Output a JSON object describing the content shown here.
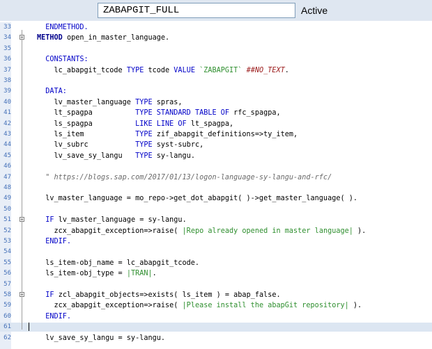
{
  "header": {
    "program_name": "ZABAPGIT_FULL",
    "status": "Active"
  },
  "editor": {
    "lines": [
      {
        "num": "33",
        "fold": false,
        "segments": [
          {
            "t": "  ENDMETHOD.",
            "c": "kw"
          }
        ]
      },
      {
        "num": "34",
        "fold": true,
        "segments": [
          {
            "t": "METHOD",
            "c": "kwb"
          },
          {
            "t": " open_in_master_language."
          }
        ]
      },
      {
        "num": "35",
        "fold": false,
        "segments": []
      },
      {
        "num": "36",
        "fold": false,
        "segments": [
          {
            "t": "  CONSTANTS:",
            "c": "kw"
          }
        ]
      },
      {
        "num": "37",
        "fold": false,
        "segments": [
          {
            "t": "    lc_abapgit_tcode "
          },
          {
            "t": "TYPE",
            "c": "kw"
          },
          {
            "t": " tcode "
          },
          {
            "t": "VALUE",
            "c": "kw"
          },
          {
            "t": " "
          },
          {
            "t": "`ZABAPGIT`",
            "c": "str"
          },
          {
            "t": " "
          },
          {
            "t": "##NO_TEXT",
            "c": "pragma"
          },
          {
            "t": "."
          }
        ]
      },
      {
        "num": "38",
        "fold": false,
        "segments": []
      },
      {
        "num": "39",
        "fold": false,
        "segments": [
          {
            "t": "  DATA:",
            "c": "kw"
          }
        ]
      },
      {
        "num": "40",
        "fold": false,
        "segments": [
          {
            "t": "    lv_master_language "
          },
          {
            "t": "TYPE",
            "c": "kw"
          },
          {
            "t": " spras,"
          }
        ]
      },
      {
        "num": "41",
        "fold": false,
        "segments": [
          {
            "t": "    lt_spagpa          "
          },
          {
            "t": "TYPE STANDARD TABLE OF",
            "c": "kw"
          },
          {
            "t": " rfc_spagpa,"
          }
        ]
      },
      {
        "num": "42",
        "fold": false,
        "segments": [
          {
            "t": "    ls_spagpa          "
          },
          {
            "t": "LIKE LINE OF",
            "c": "kw"
          },
          {
            "t": " lt_spagpa,"
          }
        ]
      },
      {
        "num": "43",
        "fold": false,
        "segments": [
          {
            "t": "    ls_item            "
          },
          {
            "t": "TYPE",
            "c": "kw"
          },
          {
            "t": " zif_abapgit_definitions=>ty_item,"
          }
        ]
      },
      {
        "num": "44",
        "fold": false,
        "segments": [
          {
            "t": "    lv_subrc           "
          },
          {
            "t": "TYPE",
            "c": "kw"
          },
          {
            "t": " syst-subrc,"
          }
        ]
      },
      {
        "num": "45",
        "fold": false,
        "segments": [
          {
            "t": "    lv_save_sy_langu   "
          },
          {
            "t": "TYPE",
            "c": "kw"
          },
          {
            "t": " sy-langu."
          }
        ]
      },
      {
        "num": "46",
        "fold": false,
        "segments": []
      },
      {
        "num": "47",
        "fold": false,
        "segments": [
          {
            "t": "  \" https://blogs.sap.com/2017/01/13/logon-language-sy-langu-and-rfc/",
            "c": "com"
          }
        ]
      },
      {
        "num": "48",
        "fold": false,
        "segments": []
      },
      {
        "num": "49",
        "fold": false,
        "segments": [
          {
            "t": "  lv_master_language = mo_repo->get_dot_abapgit( )->get_master_language( )."
          }
        ]
      },
      {
        "num": "50",
        "fold": false,
        "segments": []
      },
      {
        "num": "51",
        "fold": true,
        "segments": [
          {
            "t": "  "
          },
          {
            "t": "IF",
            "c": "kw"
          },
          {
            "t": " lv_master_language = sy-langu."
          }
        ]
      },
      {
        "num": "52",
        "fold": false,
        "segments": [
          {
            "t": "    zcx_abapgit_exception=>raise( "
          },
          {
            "t": "|Repo already opened in master language|",
            "c": "str"
          },
          {
            "t": " )."
          }
        ]
      },
      {
        "num": "53",
        "fold": false,
        "segments": [
          {
            "t": "  ENDIF.",
            "c": "kw"
          }
        ]
      },
      {
        "num": "54",
        "fold": false,
        "segments": []
      },
      {
        "num": "55",
        "fold": false,
        "segments": [
          {
            "t": "  ls_item-obj_name = lc_abapgit_tcode."
          }
        ]
      },
      {
        "num": "56",
        "fold": false,
        "segments": [
          {
            "t": "  ls_item-obj_type = "
          },
          {
            "t": "|TRAN|",
            "c": "str"
          },
          {
            "t": "."
          }
        ]
      },
      {
        "num": "57",
        "fold": false,
        "segments": []
      },
      {
        "num": "58",
        "fold": true,
        "segments": [
          {
            "t": "  "
          },
          {
            "t": "IF",
            "c": "kw"
          },
          {
            "t": " zcl_abapgit_objects=>exists( ls_item ) = abap_false."
          }
        ]
      },
      {
        "num": "59",
        "fold": false,
        "segments": [
          {
            "t": "    zcx_abapgit_exception=>raise( "
          },
          {
            "t": "|Please install the abapGit repository|",
            "c": "str"
          },
          {
            "t": " )."
          }
        ]
      },
      {
        "num": "60",
        "fold": false,
        "segments": [
          {
            "t": "  ENDIF.",
            "c": "kw"
          }
        ]
      },
      {
        "num": "61",
        "fold": false,
        "current": true,
        "segments": []
      },
      {
        "num": "62",
        "fold": false,
        "segments": [
          {
            "t": "  lv_save_sy_langu = sy-langu."
          }
        ]
      }
    ]
  }
}
